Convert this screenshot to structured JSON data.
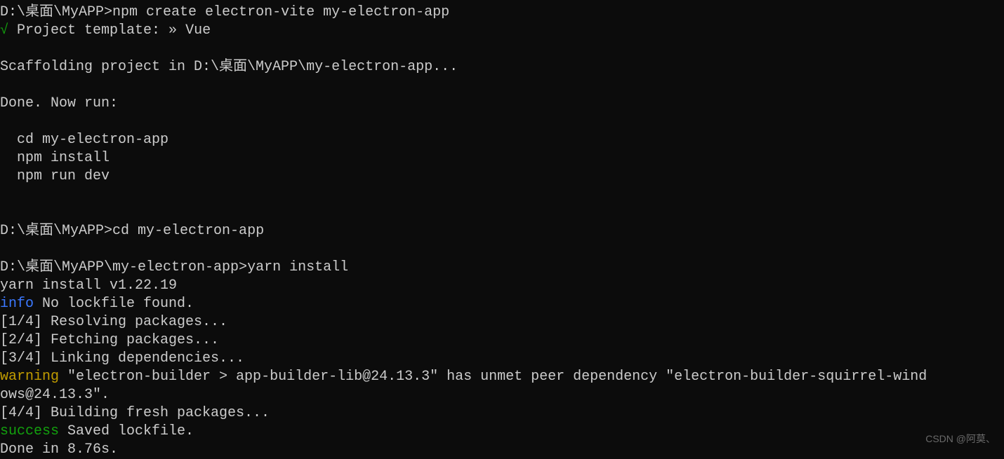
{
  "terminal": {
    "prompt1": "D:\\桌面\\MyAPP>",
    "cmd1": "npm create electron-vite my-electron-app",
    "check": "√",
    "templateLabel": " Project template: » ",
    "templateValue": "Vue",
    "blank": "",
    "scaffold": "Scaffolding project in D:\\桌面\\MyAPP\\my-electron-app...",
    "done": "Done. Now run:",
    "step1": "  cd my-electron-app",
    "step2": "  npm install",
    "step3": "  npm run dev",
    "prompt2": "D:\\桌面\\MyAPP>",
    "cmd2": "cd my-electron-app",
    "prompt3": "D:\\桌面\\MyAPP\\my-electron-app>",
    "cmd3": "yarn install",
    "yarnVersion": "yarn install v1.22.19",
    "infoLabel": "info",
    "infoText": " No lockfile found.",
    "stage1": "[1/4] Resolving packages...",
    "stage2": "[2/4] Fetching packages...",
    "stage3": "[3/4] Linking dependencies...",
    "warningLabel": "warning",
    "warningText1": " \"electron-builder > app-builder-lib@24.13.3\" has unmet peer dependency \"electron-builder-squirrel-wind",
    "warningText2": "ows@24.13.3\".",
    "stage4": "[4/4] Building fresh packages...",
    "successLabel": "success",
    "successText": " Saved lockfile.",
    "doneTime": "Done in 8.76s."
  },
  "watermark": "CSDN @阿莫、"
}
